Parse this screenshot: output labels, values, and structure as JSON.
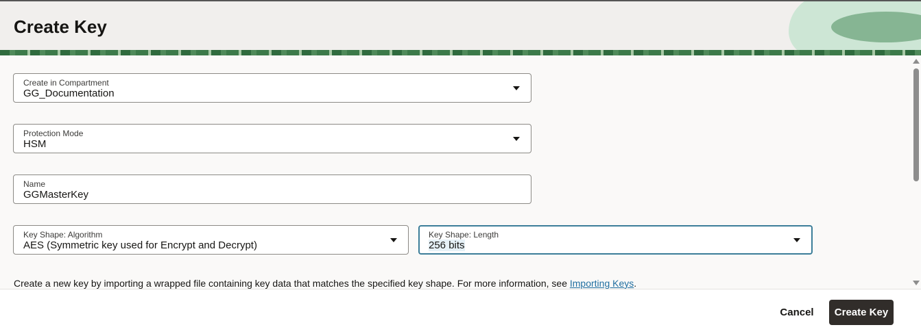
{
  "header": {
    "title": "Create Key"
  },
  "form": {
    "compartment": {
      "label": "Create in Compartment",
      "value": "GG_Documentation"
    },
    "protection_mode": {
      "label": "Protection Mode",
      "value": "HSM"
    },
    "name": {
      "label": "Name",
      "value": "GGMasterKey"
    },
    "algorithm": {
      "label": "Key Shape: Algorithm",
      "value": "AES (Symmetric key used for Encrypt and Decrypt)"
    },
    "length": {
      "label": "Key Shape: Length",
      "value": "256 bits"
    },
    "info_text": "Create a new key by importing a wrapped file containing key data that matches the specified key shape. For more information, see ",
    "info_link": "Importing Keys",
    "info_end": "."
  },
  "footer": {
    "cancel": "Cancel",
    "create": "Create Key"
  }
}
